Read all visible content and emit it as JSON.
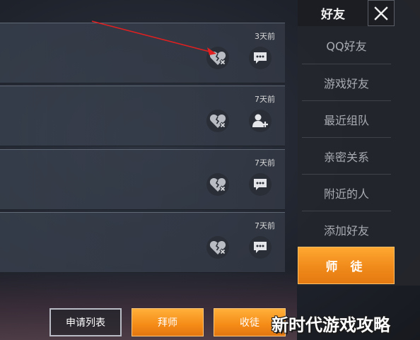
{
  "sidebar": {
    "title": "好友",
    "items": [
      {
        "label": "QQ好友"
      },
      {
        "label": "游戏好友"
      },
      {
        "label": "最近组队"
      },
      {
        "label": "亲密关系"
      },
      {
        "label": "附近的人"
      },
      {
        "label": "添加好友"
      }
    ],
    "active_label": "师 徒"
  },
  "rows": [
    {
      "time": "3天前",
      "heart_icon": "broken-heart-icon",
      "action_icon": "chat-icon"
    },
    {
      "time": "7天前",
      "heart_icon": "broken-heart-icon",
      "action_icon": "add-friend-icon"
    },
    {
      "time": "7天前",
      "heart_icon": "broken-heart-icon",
      "action_icon": "chat-icon"
    },
    {
      "time": "7天前",
      "heart_icon": "broken-heart-icon",
      "action_icon": "chat-icon"
    }
  ],
  "buttons": {
    "apply_list": "申请列表",
    "find_master": "拜师",
    "take_disciple": "收徒"
  },
  "watermark": "新时代游戏攻略",
  "colors": {
    "accent_orange": "#f58b17",
    "annotation_red": "#e02020"
  }
}
